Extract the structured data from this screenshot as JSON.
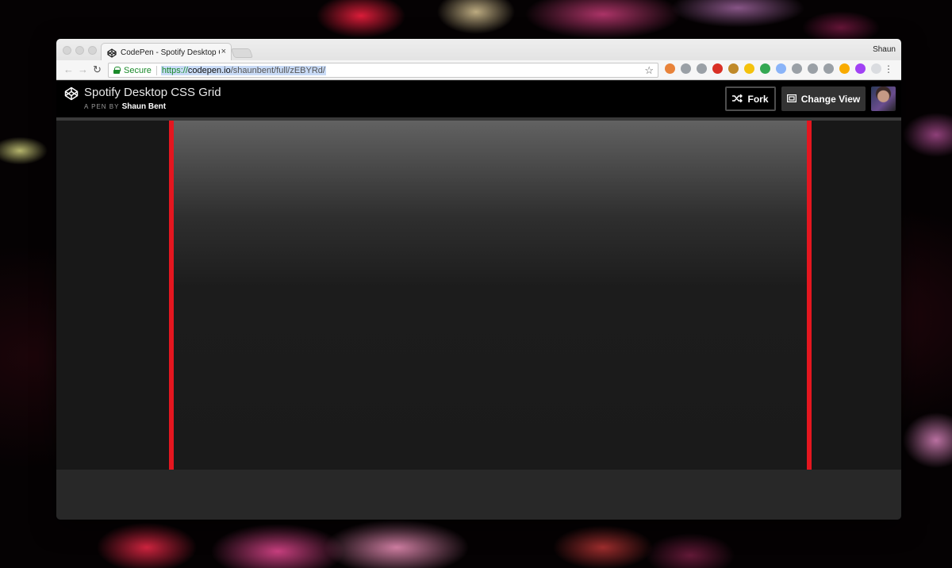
{
  "browser": {
    "tab_title": "CodePen - Spotify Desktop CSS Grid",
    "tab_close": "×",
    "profile_name": "Shaun",
    "secure_label": "Secure",
    "url": {
      "scheme": "https://",
      "host": "codepen.io",
      "path": "/shaunbent/full/zEBYRd/"
    },
    "star": "☆",
    "menu": "⋮",
    "extension_colors": [
      "#e8833a",
      "#9aa0a6",
      "#9aa0a6",
      "#d93025",
      "#c08a2a",
      "#f4c20d",
      "#34a853",
      "#8ab4f8",
      "#9aa0a6",
      "#9aa0a6",
      "#9aa0a6",
      "#f9ab00",
      "#a142f4",
      "#dadce0"
    ]
  },
  "codepen": {
    "pen_title": "Spotify Desktop CSS Grid",
    "byline_prefix": "A PEN BY",
    "author": "Shaun Bent",
    "fork_label": "Fork",
    "change_view_label": "Change View"
  },
  "colors": {
    "accent_red": "#e4161f",
    "header_bg": "#000000",
    "preview_bg": "#181818"
  }
}
